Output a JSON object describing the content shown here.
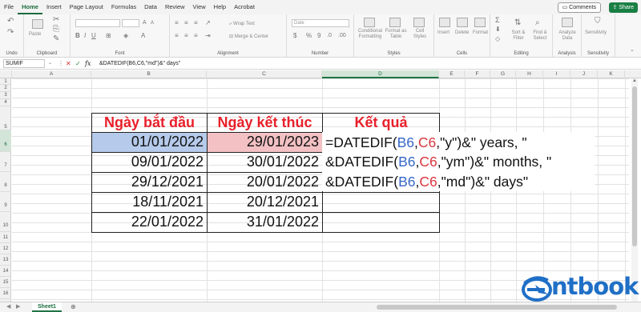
{
  "menu": {
    "tabs": [
      "File",
      "Home",
      "Insert",
      "Page Layout",
      "Formulas",
      "Data",
      "Review",
      "View",
      "Help",
      "Acrobat"
    ],
    "active": "Home",
    "comments_label": "Comments",
    "share_label": "Share"
  },
  "ribbon": {
    "groups": {
      "undo": "Undo",
      "clipboard": "Clipboard",
      "font": "Font",
      "alignment": "Alignment",
      "number": "Number",
      "styles": "Styles",
      "cells": "Cells",
      "editing": "Editing",
      "analysis": "Analysis",
      "sensitivity": "Sensitivity"
    },
    "paste_label": "Paste",
    "wrap_text": "Wrap Text",
    "merge_center": "Merge & Center",
    "number_format": "Date",
    "conditional_formatting": "Conditional Formatting",
    "format_as_table": "Format as Table",
    "cell_styles": "Cell Styles",
    "insert": "Insert",
    "delete": "Delete",
    "format": "Format",
    "sort_filter": "Sort & Filter",
    "find_select": "Find & Select",
    "analyze_data": "Analyze Data",
    "sensitivity_btn": "Sensitivity"
  },
  "formula_bar": {
    "name_box": "SUMIF",
    "formula": "&DATEDIF(B6,C6,\"md\")&\" days\""
  },
  "columns": [
    "A",
    "B",
    "C",
    "D",
    "E",
    "F",
    "G",
    "H",
    "I",
    "J",
    "K"
  ],
  "selected_column": "D",
  "selected_row": "6",
  "rows": [
    "1",
    "2",
    "3",
    "4",
    "5",
    "6",
    "7",
    "8",
    "9",
    "10",
    "11",
    "12",
    "13",
    "14",
    "15",
    "16"
  ],
  "table": {
    "headers": [
      "Ngày bắt đầu",
      "Ngày kết thúc",
      "Kết quả"
    ],
    "start_dates": [
      "01/01/2022",
      "09/01/2022",
      "29/12/2021",
      "18/11/2021",
      "22/01/2022"
    ],
    "end_dates": [
      "29/01/2023",
      "30/01/2022",
      "20/01/2022",
      "20/12/2021",
      "31/01/2022"
    ]
  },
  "formula_lines": {
    "l1_a": "=DATEDIF(",
    "l1_b": "B6",
    "l1_c": ",",
    "l1_d": "C6",
    "l1_e": ",\"y\")&\" years, \"",
    "l2_a": "&DATEDIF(",
    "l2_b": "B6",
    "l2_c": ",",
    "l2_d": "C6",
    "l2_e": ",\"ym\")&\" months, \"",
    "l3_a": "&DATEDIF(",
    "l3_b": "B6",
    "l3_c": ",",
    "l3_d": "C6",
    "l3_e": ",\"md\")&\" days\""
  },
  "sheet_tab": "Sheet1",
  "logo_text": "ntbook",
  "colors": {
    "header_text": "#e8202a",
    "b6_fill": "#b6cbeb",
    "c6_fill": "#f3c1c4",
    "ref_blue": "#3667c8",
    "ref_red": "#d9363e",
    "excel_green": "#217346"
  }
}
